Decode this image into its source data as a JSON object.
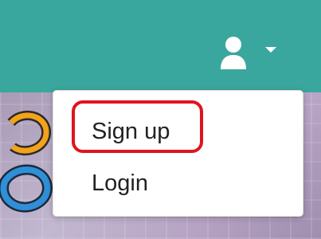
{
  "navbar": {
    "background": "#3aa79e",
    "user_icon": "user-icon",
    "caret_icon": "caret-down-icon"
  },
  "dropdown": {
    "items": [
      {
        "label": "Sign up",
        "highlighted": true
      },
      {
        "label": "Login",
        "highlighted": false
      }
    ],
    "highlight_color": "#e0141e"
  }
}
